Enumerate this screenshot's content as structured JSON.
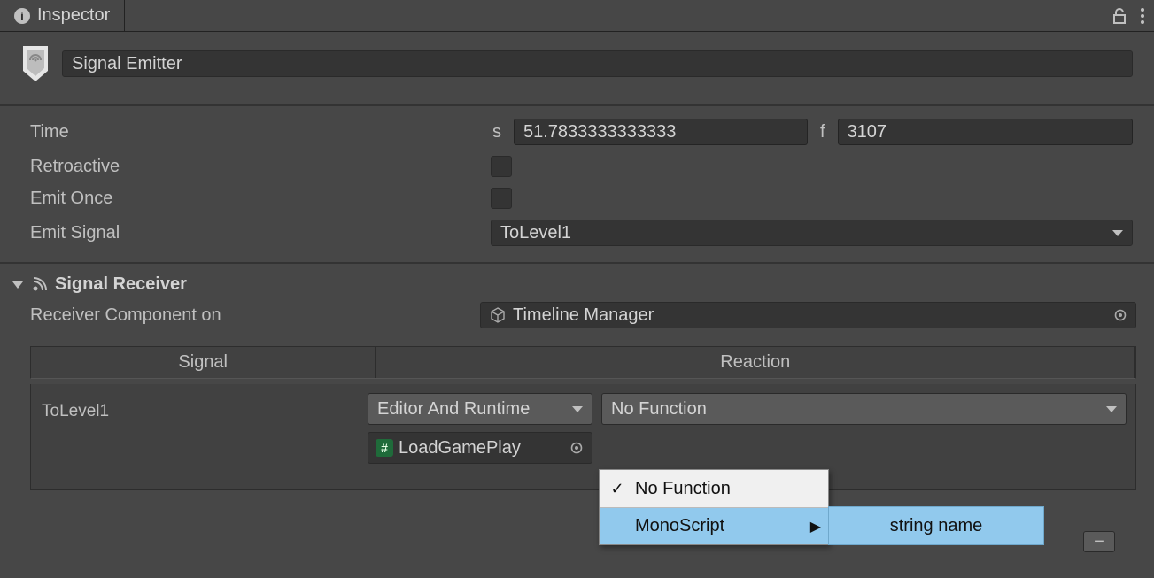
{
  "tab": {
    "title": "Inspector"
  },
  "header": {
    "name": "Signal Emitter"
  },
  "props": {
    "time_label": "Time",
    "time_s_label": "s",
    "time_s_value": "51.7833333333333",
    "time_f_label": "f",
    "time_f_value": "3107",
    "retroactive_label": "Retroactive",
    "emit_once_label": "Emit Once",
    "emit_signal_label": "Emit Signal",
    "emit_signal_value": "ToLevel1"
  },
  "receiver": {
    "section_title": "Signal Receiver",
    "rc_label": "Receiver Component on",
    "rc_value": "Timeline Manager",
    "col_signal": "Signal",
    "col_reaction": "Reaction",
    "signal_name": "ToLevel1",
    "mode_value": "Editor And Runtime",
    "func_value": "No Function",
    "obj_value": "LoadGamePlay"
  },
  "popup": {
    "items": [
      {
        "label": "No Function",
        "checked": true
      },
      {
        "label": "MonoScript",
        "submenu": true
      }
    ],
    "submenu_item": "string name"
  }
}
